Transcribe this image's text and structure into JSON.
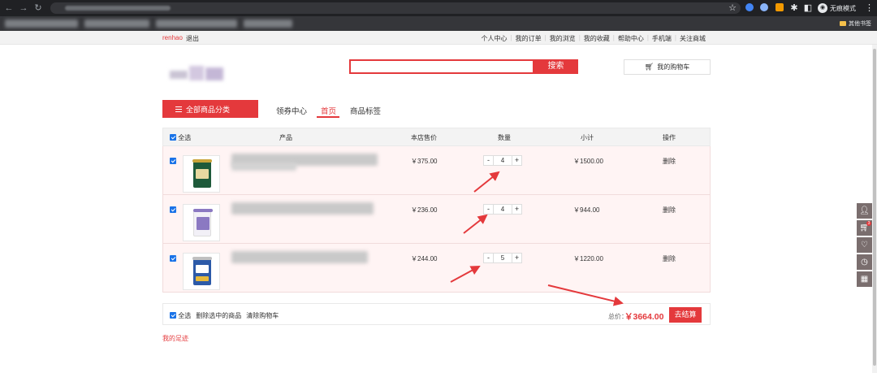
{
  "browser": {
    "incognito_label": "无痕模式",
    "bookmarks_other": "其他书签"
  },
  "topbar": {
    "username": "renhao",
    "logout": "退出",
    "links": [
      "个人中心",
      "我的订单",
      "我的浏览",
      "我的收藏",
      "帮助中心",
      "手机端",
      "关注商城"
    ]
  },
  "header": {
    "search_placeholder": "",
    "search_button": "搜索",
    "cart_button": "我的购物车"
  },
  "nav": {
    "all_categories": "全部商品分类",
    "items": [
      "领券中心",
      "首页",
      "商品标签"
    ],
    "active_index": 1
  },
  "cart": {
    "columns": {
      "select_all": "全选",
      "product": "产品",
      "price": "本店售价",
      "quantity": "数量",
      "subtotal": "小计",
      "action": "操作"
    },
    "items": [
      {
        "price": "￥375.00",
        "quantity": "4",
        "subtotal": "￥1500.00",
        "delete": "删除",
        "checked": true,
        "image_color": "#1e5a3a"
      },
      {
        "price": "￥236.00",
        "quantity": "4",
        "subtotal": "￥944.00",
        "delete": "删除",
        "checked": true,
        "image_color": "#8b79c2"
      },
      {
        "price": "￥244.00",
        "quantity": "5",
        "subtotal": "￥1220.00",
        "delete": "删除",
        "checked": true,
        "image_color": "#2c5aa8"
      }
    ],
    "qty_minus": "-",
    "qty_plus": "+"
  },
  "footer": {
    "select_all": "全选",
    "delete_selected": "删除选中的商品",
    "clear_cart": "清除购物车",
    "total_label": "总价：",
    "total_value": "￥3664.00",
    "checkout": "去结算"
  },
  "footprint": "我的足迹",
  "sidebar": {
    "cart_badge": "3",
    "icons": [
      "user-icon",
      "cart-icon",
      "heart-icon",
      "clock-icon",
      "qrcode-icon"
    ]
  },
  "colors": {
    "brand_red": "#e4393c",
    "row_bg": "#fff4f4",
    "sidebar_bg": "#7a6e6e"
  }
}
